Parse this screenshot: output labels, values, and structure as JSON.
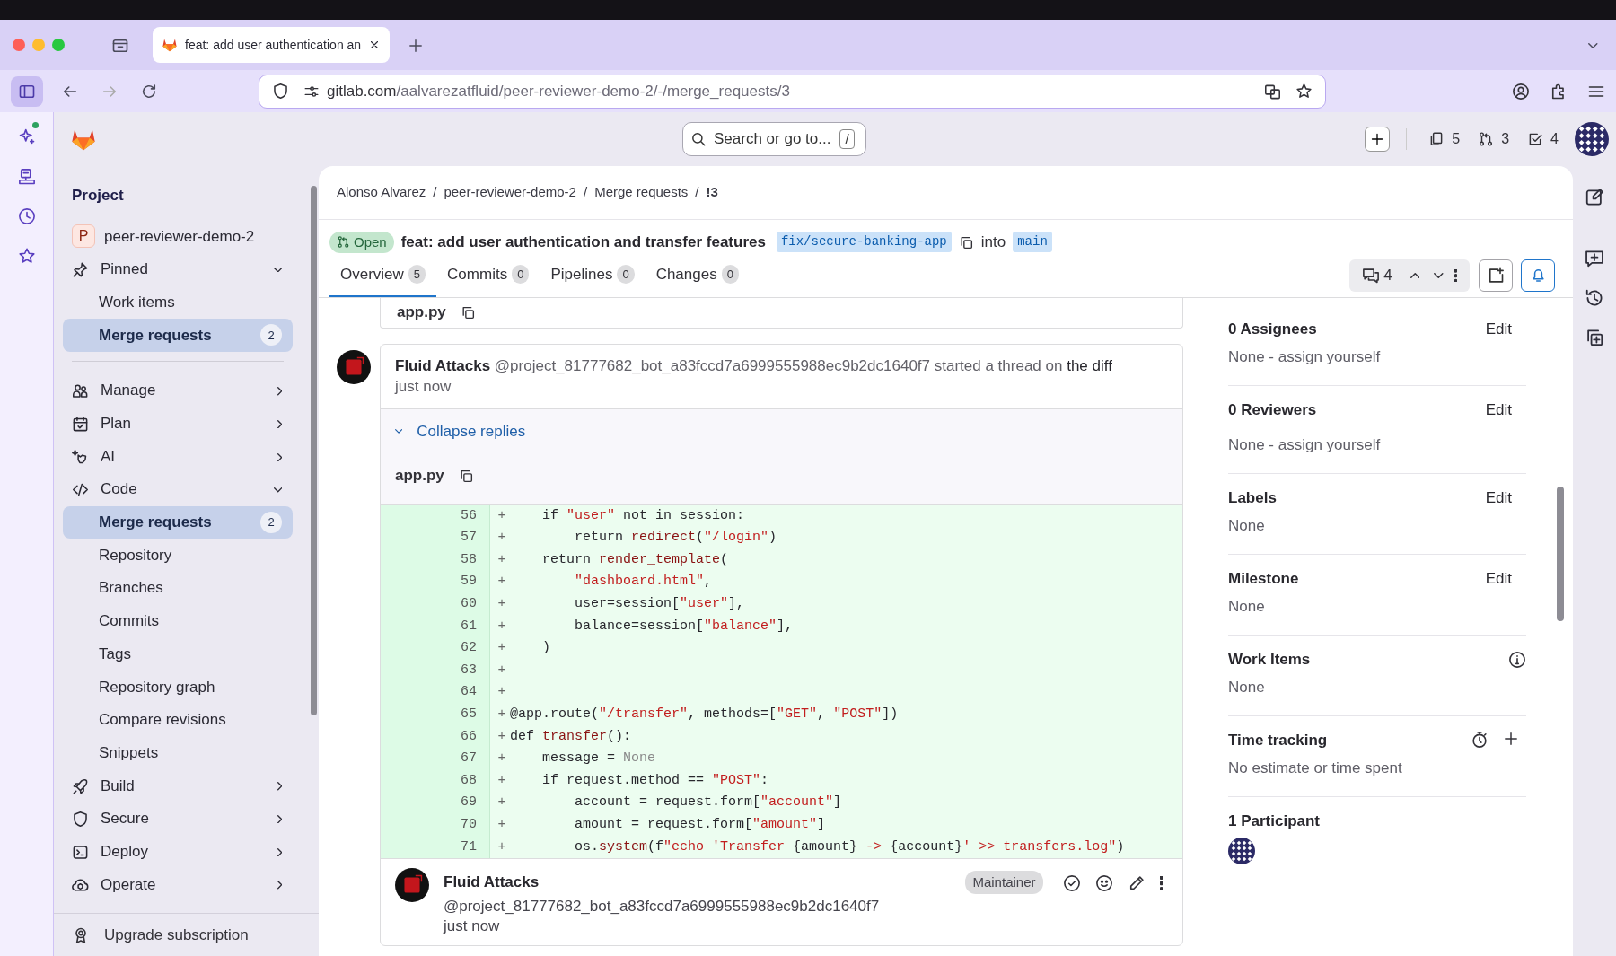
{
  "browser": {
    "tab_title": "feat: add user authentication an",
    "address_host": "gitlab.com",
    "address_path": "/aalvarezatfluid/peer-reviewer-demo-2/-/merge_requests/3"
  },
  "top_bar": {
    "search_placeholder": "Search or go to...",
    "search_shortcut": "/",
    "counters": [
      {
        "value": "5"
      },
      {
        "value": "3"
      },
      {
        "value": "4"
      }
    ]
  },
  "sidebar": {
    "heading": "Project",
    "project": {
      "initial": "P",
      "name": "peer-reviewer-demo-2"
    },
    "items": [
      {
        "kind": "section",
        "label": "Pinned",
        "expanded": true
      },
      {
        "kind": "link",
        "label": "Work items",
        "selected": false
      },
      {
        "kind": "link",
        "label": "Merge requests",
        "selected": true,
        "badge": "2"
      },
      {
        "kind": "divider"
      },
      {
        "kind": "section",
        "label": "Manage",
        "expanded": false
      },
      {
        "kind": "section",
        "label": "Plan",
        "expanded": false
      },
      {
        "kind": "section",
        "label": "AI",
        "expanded": false
      },
      {
        "kind": "section",
        "label": "Code",
        "expanded": true
      },
      {
        "kind": "link",
        "label": "Merge requests",
        "selected": true,
        "badge": "2"
      },
      {
        "kind": "link",
        "label": "Repository",
        "selected": false
      },
      {
        "kind": "link",
        "label": "Branches",
        "selected": false
      },
      {
        "kind": "link",
        "label": "Commits",
        "selected": false
      },
      {
        "kind": "link",
        "label": "Tags",
        "selected": false
      },
      {
        "kind": "link",
        "label": "Repository graph",
        "selected": false
      },
      {
        "kind": "link",
        "label": "Compare revisions",
        "selected": false
      },
      {
        "kind": "link",
        "label": "Snippets",
        "selected": false
      },
      {
        "kind": "section",
        "label": "Build",
        "expanded": false
      },
      {
        "kind": "section",
        "label": "Secure",
        "expanded": false
      },
      {
        "kind": "section",
        "label": "Deploy",
        "expanded": false
      },
      {
        "kind": "section",
        "label": "Operate",
        "expanded": false
      }
    ],
    "footer": "Upgrade subscription"
  },
  "breadcrumb": {
    "separator": "/",
    "items": [
      "Alonso Alvarez",
      "peer-reviewer-demo-2",
      "Merge requests",
      "!3"
    ]
  },
  "merge_request": {
    "status": "Open",
    "title": "feat: add user authentication and transfer features",
    "source_branch": "fix/secure-banking-app",
    "into": "into",
    "target_branch": "main"
  },
  "tabs": [
    {
      "label": "Overview",
      "count": "5",
      "selected": true
    },
    {
      "label": "Commits",
      "count": "0",
      "selected": false
    },
    {
      "label": "Pipelines",
      "count": "0",
      "selected": false
    },
    {
      "label": "Changes",
      "count": "0",
      "selected": false
    }
  ],
  "thread_count": "4",
  "previous_file": "app.py",
  "thread": {
    "author": "Fluid Attacks",
    "handle": "@project_81777682_bot_a83fccd7a6999555988ec9b2dc1640f7",
    "action": "started a thread on",
    "link": "the diff",
    "time": "just now",
    "collapse_label": "Collapse replies",
    "file": "app.py",
    "lines": [
      {
        "num": "56",
        "sign": "+",
        "code": [
          {
            "text": "    if ",
            "kind": "plain"
          },
          {
            "text": "\"user\"",
            "kind": "string"
          },
          {
            "text": " not in session:",
            "kind": "plain"
          }
        ]
      },
      {
        "num": "57",
        "sign": "+",
        "code": [
          {
            "text": "        return ",
            "kind": "plain"
          },
          {
            "text": "redirect",
            "kind": "func"
          },
          {
            "text": "(",
            "kind": "plain"
          },
          {
            "text": "\"/login\"",
            "kind": "string"
          },
          {
            "text": ")",
            "kind": "plain"
          }
        ]
      },
      {
        "num": "58",
        "sign": "+",
        "code": [
          {
            "text": "    return ",
            "kind": "plain"
          },
          {
            "text": "render_template",
            "kind": "func"
          },
          {
            "text": "(",
            "kind": "plain"
          }
        ]
      },
      {
        "num": "59",
        "sign": "+",
        "code": [
          {
            "text": "        \"dashboard.html\"",
            "kind": "string"
          },
          {
            "text": ",",
            "kind": "plain"
          }
        ]
      },
      {
        "num": "60",
        "sign": "+",
        "code": [
          {
            "text": "        user=session[",
            "kind": "plain"
          },
          {
            "text": "\"user\"",
            "kind": "string"
          },
          {
            "text": "],",
            "kind": "plain"
          }
        ]
      },
      {
        "num": "61",
        "sign": "+",
        "code": [
          {
            "text": "        balance=session[",
            "kind": "plain"
          },
          {
            "text": "\"balance\"",
            "kind": "string"
          },
          {
            "text": "],",
            "kind": "plain"
          }
        ]
      },
      {
        "num": "62",
        "sign": "+",
        "code": [
          {
            "text": "    )",
            "kind": "plain"
          }
        ]
      },
      {
        "num": "63",
        "sign": "+"
      },
      {
        "num": "64",
        "sign": "+"
      },
      {
        "num": "65",
        "sign": "+",
        "code": [
          {
            "text": "@app.route(",
            "kind": "plain"
          },
          {
            "text": "\"/transfer\"",
            "kind": "string"
          },
          {
            "text": ", methods=[",
            "kind": "plain"
          },
          {
            "text": "\"GET\"",
            "kind": "string"
          },
          {
            "text": ", ",
            "kind": "plain"
          },
          {
            "text": "\"POST\"",
            "kind": "string"
          },
          {
            "text": "])",
            "kind": "plain"
          }
        ]
      },
      {
        "num": "66",
        "sign": "+",
        "code": [
          {
            "text": "def ",
            "kind": "plain"
          },
          {
            "text": "transfer",
            "kind": "func"
          },
          {
            "text": "():",
            "kind": "plain"
          }
        ]
      },
      {
        "num": "67",
        "sign": "+",
        "code": [
          {
            "text": "    message = ",
            "kind": "plain"
          },
          {
            "text": "None",
            "kind": "constant"
          }
        ]
      },
      {
        "num": "68",
        "sign": "+",
        "code": [
          {
            "text": "    if request.method == ",
            "kind": "plain"
          },
          {
            "text": "\"POST\"",
            "kind": "string"
          },
          {
            "text": ":",
            "kind": "plain"
          }
        ]
      },
      {
        "num": "69",
        "sign": "+",
        "code": [
          {
            "text": "        account = request.form[",
            "kind": "plain"
          },
          {
            "text": "\"account\"",
            "kind": "string"
          },
          {
            "text": "]",
            "kind": "plain"
          }
        ]
      },
      {
        "num": "70",
        "sign": "+",
        "code": [
          {
            "text": "        amount = request.form[",
            "kind": "plain"
          },
          {
            "text": "\"amount\"",
            "kind": "string"
          },
          {
            "text": "]",
            "kind": "plain"
          }
        ]
      },
      {
        "num": "71",
        "sign": "+",
        "code": [
          {
            "text": "        os.",
            "kind": "plain"
          },
          {
            "text": "system",
            "kind": "func"
          },
          {
            "text": "(f",
            "kind": "plain"
          },
          {
            "text": "\"echo 'Transfer ",
            "kind": "string"
          },
          {
            "text": "{amount}",
            "kind": "plain"
          },
          {
            "text": " -> ",
            "kind": "string"
          },
          {
            "text": "{account}",
            "kind": "plain"
          },
          {
            "text": "' >> transfers.log\"",
            "kind": "string"
          },
          {
            "text": ")",
            "kind": "plain"
          }
        ]
      }
    ]
  },
  "reply": {
    "author": "Fluid Attacks",
    "handle": "@project_81777682_bot_a83fccd7a6999555988ec9b2dc1640f7",
    "time": "just now",
    "role": "Maintainer"
  },
  "details": [
    {
      "kind": "edit",
      "title": "0 Assignees",
      "action": "Edit",
      "value": "None - assign yourself"
    },
    {
      "kind": "edit",
      "title": "0 Reviewers",
      "action": "Edit",
      "value": "None - assign yourself"
    },
    {
      "kind": "edit",
      "title": "Labels",
      "action": "Edit",
      "value": "None"
    },
    {
      "kind": "edit",
      "title": "Milestone",
      "action": "Edit",
      "value": "None"
    },
    {
      "kind": "info",
      "title": "Work Items",
      "value": "None"
    },
    {
      "kind": "timer",
      "title": "Time tracking",
      "value": "No estimate or time spent"
    },
    {
      "kind": "participants",
      "title": "1 Participant"
    }
  ]
}
